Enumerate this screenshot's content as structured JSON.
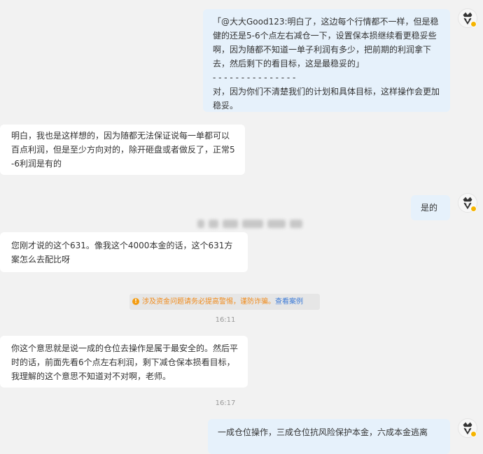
{
  "messages": [
    {
      "id": "m1",
      "side": "out",
      "text": "「@大大Good123:明白了，这边每个行情都不一样，但是稳健的还是5-6个点左右减仓一下，设置保本损继续看更稳妥些啊，因为随都不知道一单子利润有多少，把前期的利润拿下去，然后剩下的看目标，这是最稳妥的」\n- - - - - - - - - - - - - - -\n对，因为你们不清楚我们的计划和具体目标，这样操作会更加稳妥。"
    },
    {
      "id": "m2",
      "side": "in",
      "text": "明白，我也是这样想的，因为随都无法保证说每一单都可以百点利润，但是至少方向对的，除开砸盘或者做反了，正常5-6利润是有的"
    },
    {
      "id": "m3",
      "side": "out",
      "text": "是的"
    },
    {
      "id": "m4",
      "side": "in",
      "text": "您刚才说的这个631。像我这个4000本金的话，这个631方案怎么去配比呀"
    },
    {
      "id": "m5",
      "side": "in",
      "text": "你这个意思就是说一成的仓位去操作是属于最安全的。然后平时的话，前面先看6个点左右利润，剩下减仓保本损看目标，我理解的这个意思不知道对不对啊，老师。"
    },
    {
      "id": "m6",
      "side": "out",
      "text": "一成仓位操作，三成仓位抗风险保护本金，六成本金逃离"
    }
  ],
  "system_notice": {
    "icon": "warning-icon",
    "text": "涉及资金问题请务必提高警惕，谨防诈骗。",
    "link": "查看案例"
  },
  "timestamps": {
    "t1": "16:11",
    "t2": "16:17"
  },
  "colors": {
    "background": "#f2f2f2",
    "outgoing_bubble": "#e6f1fb",
    "incoming_bubble": "#ffffff",
    "notice_text": "#f08a1a",
    "notice_link": "#3d7bd6",
    "badge": "#f5b400"
  }
}
